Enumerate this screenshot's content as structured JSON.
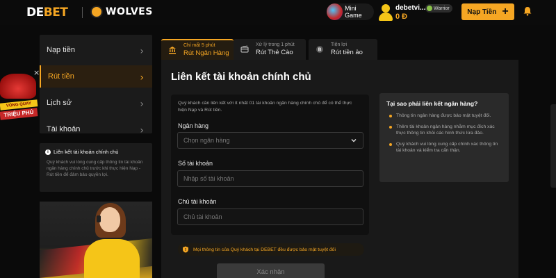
{
  "header": {
    "logo_main": "DE",
    "logo_accent": "BET",
    "partner": "WOLVES",
    "minigame_label": "Mini Game",
    "user_name": "debetvi...",
    "user_balance": "0 Đ",
    "user_rank": "Warrior",
    "deposit_label": "Nạp Tiền"
  },
  "sidebar": {
    "items": [
      {
        "label": "Nạp tiền"
      },
      {
        "label": "Rút tiền"
      },
      {
        "label": "Lịch sử"
      },
      {
        "label": "Tài khoản"
      }
    ],
    "info_title": "Liên kết tài khoản chính chủ",
    "info_body": "Quý khách vui lòng cung cấp thông tin tài khoản ngân hàng chính chủ trước khi thực hiện Nạp - Rút tiền để đảm bảo quyền lợi."
  },
  "float_promo": {
    "line1": "VÒNG QUAY",
    "line2": "TRIỆU PHÚ"
  },
  "tabs": [
    {
      "sub": "Chỉ mất 5 phút",
      "label": "Rút Ngân Hàng"
    },
    {
      "sub": "Xử lý trong 1 phút",
      "label": "Rút Thẻ Cào"
    },
    {
      "sub": "Tiện lợi",
      "label": "Rút tiền ảo"
    }
  ],
  "main": {
    "title": "Liên kết tài khoản chính chủ",
    "form_desc": "Quý khách cần liên kết với ít nhất 01 tài khoản ngân hàng chính chủ để có thể thực hiện Nạp và Rút tiền.",
    "bank_label": "Ngân hàng",
    "bank_placeholder": "Chọn ngân hàng",
    "account_number_label": "Số tài khoản",
    "account_number_placeholder": "Nhập số tài khoản",
    "account_holder_label": "Chủ tài khoản",
    "account_holder_placeholder": "Chủ tài khoản",
    "secure_note": "Mọi thông tin của Quý khách tại DEBET đều được bảo mật tuyệt đối",
    "confirm_label": "Xác nhận"
  },
  "why": {
    "title": "Tại sao phải liên kết ngân hàng?",
    "items": [
      "Thông tin ngân hàng được bảo mật tuyệt đối.",
      "Thêm tài khoản ngân hàng nhằm mục đích xác thực thông tin khỏi các hình thức lừa đảo.",
      "Quý khách vui lòng cung cấp chính xác thông tin tài khoản và kiểm tra cẩn thận."
    ]
  },
  "colors": {
    "accent": "#f5a623",
    "background": "#0a0a0a",
    "panel": "#191919"
  },
  "icons": [
    "minigame-icon",
    "avatar-icon",
    "plus-icon",
    "bell-icon",
    "chevron-right-icon",
    "info-icon",
    "bank-icon",
    "card-icon",
    "crypto-icon",
    "chevron-down-icon",
    "shield-icon",
    "close-icon"
  ]
}
